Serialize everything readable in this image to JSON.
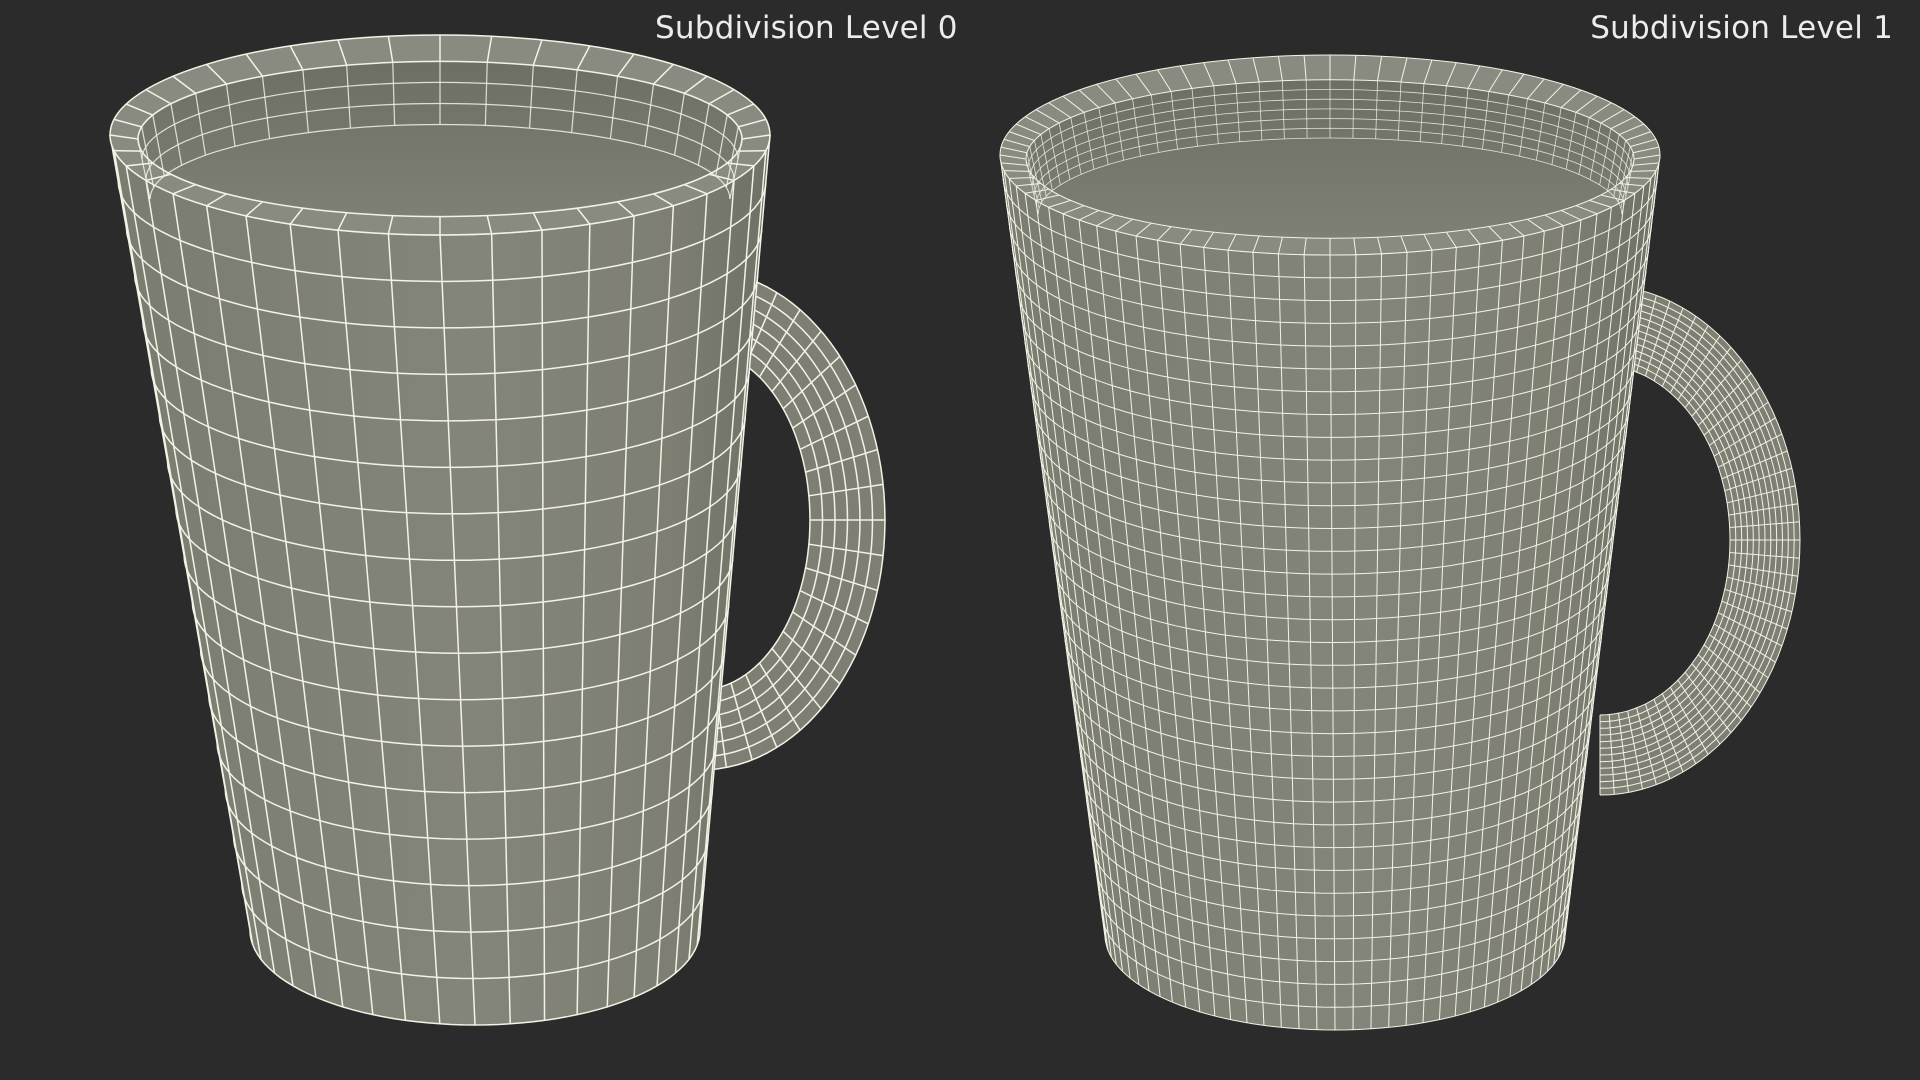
{
  "labels": {
    "left": "Subdivision Level 0",
    "right": "Subdivision Level 1"
  },
  "panels": [
    {
      "id": "level-0",
      "subdivision_level": 0,
      "grid": {
        "columns": 40,
        "rows": 17
      }
    },
    {
      "id": "level-1",
      "subdivision_level": 1,
      "grid": {
        "columns": 80,
        "rows": 34
      }
    }
  ],
  "colors": {
    "background": "#2b2b2b",
    "surface": "#7e7f72",
    "surface_dark": "#565850",
    "wire": "#f3f2e6",
    "label": "#ececec"
  }
}
